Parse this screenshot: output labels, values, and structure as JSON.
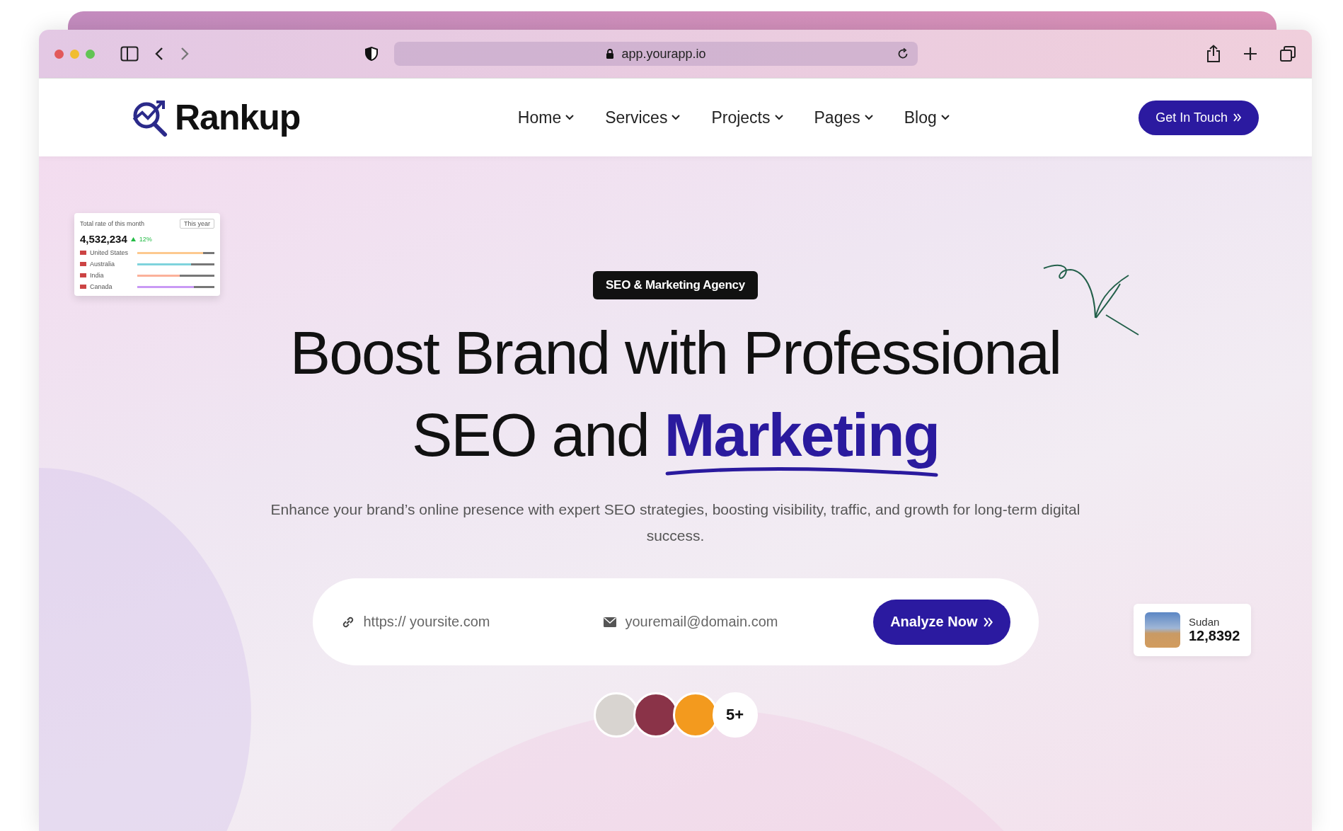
{
  "browser": {
    "url": "app.yourapp.io"
  },
  "site": {
    "logo": "Rankup",
    "nav": [
      {
        "label": "Home",
        "has_dropdown": true
      },
      {
        "label": "Services",
        "has_dropdown": true
      },
      {
        "label": "Projects",
        "has_dropdown": true
      },
      {
        "label": "Pages",
        "has_dropdown": true
      },
      {
        "label": "Blog",
        "has_dropdown": true
      }
    ],
    "cta": "Get In Touch"
  },
  "hero": {
    "badge": "SEO & Marketing Agency",
    "title_line_1": "Boost Brand with Professional",
    "title_line_2": "SEO and",
    "title_highlight": "Marketing",
    "subtitle": "Enhance your brand’s online presence with expert SEO strategies, boosting visibility, traffic, and growth for long-term digital success.",
    "form": {
      "url_placeholder": "https:// yoursite.com",
      "email_placeholder": "youremail@domain.com",
      "button": "Analyze Now"
    },
    "avatars_more": "5+"
  },
  "stats_card": {
    "title": "Total rate of this month",
    "period": "This year",
    "total": "4,532,234",
    "change": "12%",
    "rows": [
      {
        "country": "United States",
        "level": 0.85,
        "color": "#fdc98f"
      },
      {
        "country": "Australia",
        "level": 0.7,
        "color": "#7fd3dc"
      },
      {
        "country": "India",
        "level": 0.55,
        "color": "#fbb19a"
      },
      {
        "country": "Canada",
        "level": 0.73,
        "color": "#c99af5"
      }
    ]
  },
  "location_card": {
    "name": "Sudan",
    "value": "12,8392"
  }
}
